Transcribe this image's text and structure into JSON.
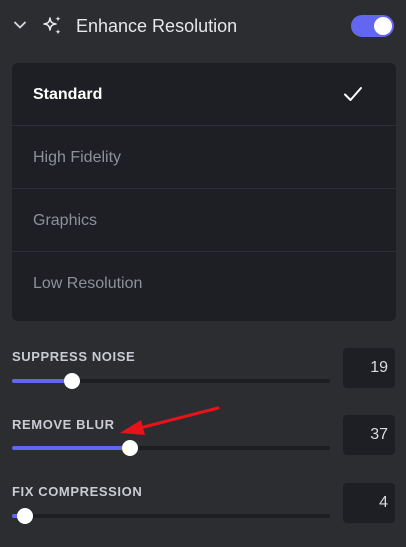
{
  "header": {
    "title": "Enhance Resolution",
    "toggle_on": true,
    "accent_color": "#6366f1",
    "chevron_icon": "chevron-down-icon",
    "feature_icon": "sparkles-icon"
  },
  "mode_menu": {
    "items": [
      {
        "label": "Standard",
        "selected": true
      },
      {
        "label": "High Fidelity",
        "selected": false
      },
      {
        "label": "Graphics",
        "selected": false
      },
      {
        "label": "Low Resolution",
        "selected": false
      }
    ],
    "check_icon": "checkmark-icon"
  },
  "sliders": [
    {
      "label": "SUPPRESS NOISE",
      "value": "19",
      "fraction": 0.19
    },
    {
      "label": "REMOVE BLUR",
      "value": "37",
      "fraction": 0.37
    },
    {
      "label": "FIX COMPRESSION",
      "value": "4",
      "fraction": 0.04
    }
  ],
  "annotation": {
    "type": "arrow",
    "color": "#e8121a",
    "points_to": "remove-blur-slider"
  }
}
